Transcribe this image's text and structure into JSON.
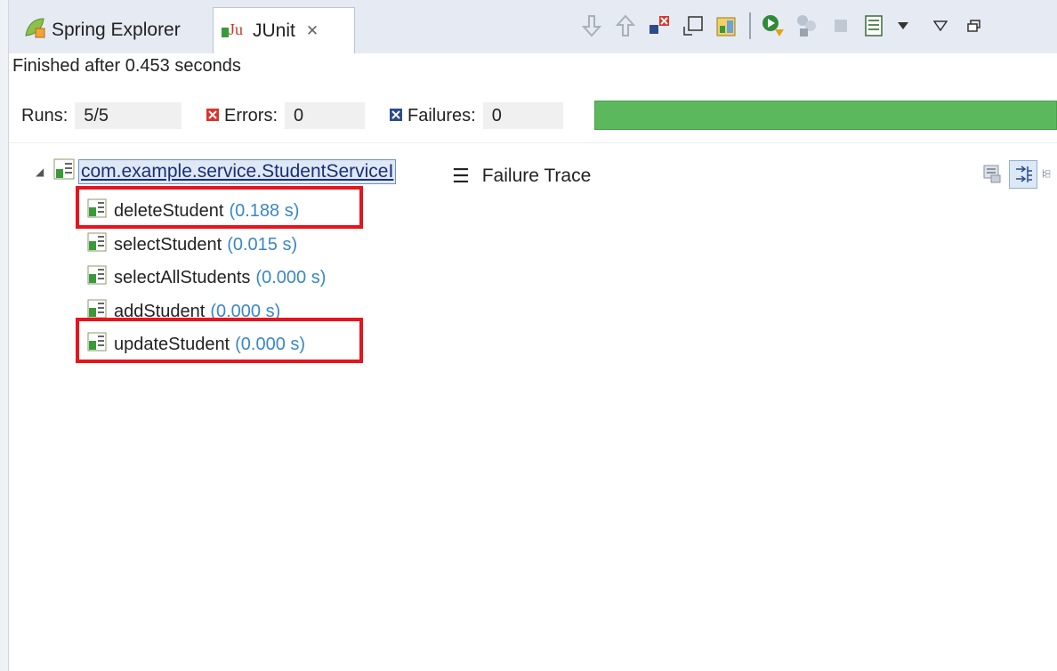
{
  "tabs": [
    {
      "label": "Spring Explorer"
    },
    {
      "label": "JUnit",
      "active": true
    }
  ],
  "toolbar_icons": [
    "next-failure-icon",
    "previous-failure-icon",
    "show-failures-only-icon",
    "scroll-lock-icon",
    "history-icon",
    "rerun-icon",
    "rerun-failed-icon",
    "stop-icon",
    "layout-icon",
    "view-menu-icon",
    "minimize-icon"
  ],
  "status": {
    "text": "Finished after 0.453 seconds"
  },
  "counters": {
    "runs_label": "Runs:",
    "runs_value": "5/5",
    "errors_label": "Errors:",
    "errors_value": "0",
    "failures_label": "Failures:",
    "failures_value": "0"
  },
  "progress": {
    "fraction": 1.0,
    "color": "#5cb85c"
  },
  "tree": {
    "root": "com.example.service.StudentServiceI",
    "items": [
      {
        "name": "deleteStudent",
        "time": "(0.188 s)",
        "highlighted": true
      },
      {
        "name": "selectStudent",
        "time": "(0.015 s)",
        "highlighted": false
      },
      {
        "name": "selectAllStudents",
        "time": "(0.000 s)",
        "highlighted": false
      },
      {
        "name": "addStudent",
        "time": "(0.000 s)",
        "highlighted": false
      },
      {
        "name": "updateStudent",
        "time": "(0.000 s)",
        "highlighted": true
      }
    ]
  },
  "trace": {
    "title": "Failure Trace"
  },
  "colors": {
    "highlight": "#e8141c",
    "success": "#5cb85c",
    "time": "#3a86c8"
  }
}
